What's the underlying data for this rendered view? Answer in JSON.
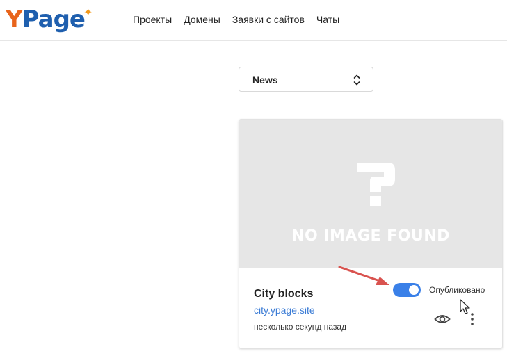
{
  "header": {
    "logo": {
      "y": "Y",
      "rest": "Page",
      "star": "✦"
    },
    "nav": [
      "Проекты",
      "Домены",
      "Заявки с сайтов",
      "Чаты"
    ]
  },
  "filter": {
    "selected": "News",
    "icon": "chevron-up-down-icon"
  },
  "card": {
    "image_placeholder": {
      "symbol": "?",
      "text": "NO IMAGE FOUND"
    },
    "title": "City blocks",
    "link": "city.ypage.site",
    "time": "несколько секунд назад",
    "toggle": {
      "on": true,
      "label": "Опубликовано"
    },
    "actions": {
      "view_icon": "eye-icon",
      "more_icon": "more-vertical-icon"
    }
  },
  "colors": {
    "accent": "#3a80e8",
    "logo_orange": "#e8641b",
    "logo_blue": "#1f5fae",
    "link": "#3a7bd5",
    "annotation_arrow": "#d9534f"
  }
}
